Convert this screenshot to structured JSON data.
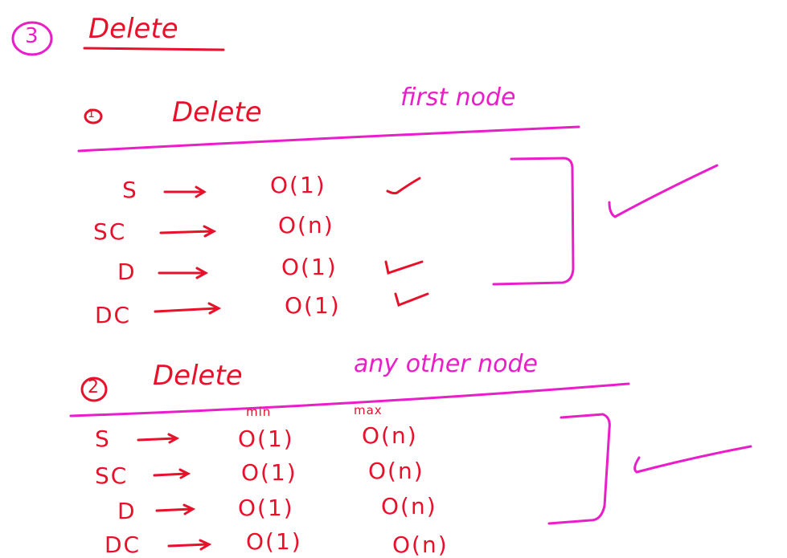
{
  "colors": {
    "red_ink": "#e8102a",
    "pink_ink": "#ea1ec9"
  },
  "heading": {
    "number": "3",
    "title": "Delete"
  },
  "section1": {
    "number": "1",
    "title_word1": "Delete",
    "title_word2": "first node",
    "rows": [
      {
        "label": "S",
        "value": "O(1)"
      },
      {
        "label": "SC",
        "value": "O(n)"
      },
      {
        "label": "D",
        "value": "O(1)"
      },
      {
        "label": "DC",
        "value": "O(1)"
      }
    ]
  },
  "section2": {
    "number": "2",
    "title_word1": "Delete",
    "title_word2": "any other node",
    "col_min": "min",
    "col_max": "max",
    "rows": [
      {
        "label": "S",
        "min": "O(1)",
        "max": "O(n)"
      },
      {
        "label": "SC",
        "min": "O(1)",
        "max": "O(n)"
      },
      {
        "label": "D",
        "min": "O(1)",
        "max": "O(n)"
      },
      {
        "label": "DC",
        "min": "O(1)",
        "max": "O(n)"
      }
    ]
  }
}
